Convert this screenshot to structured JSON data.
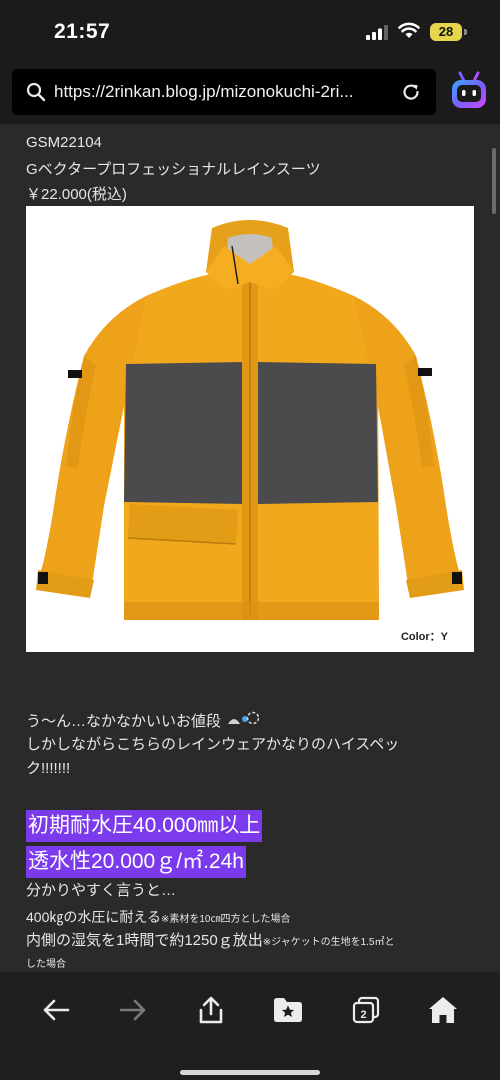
{
  "status_bar": {
    "time": "21:57",
    "battery": "28"
  },
  "browser": {
    "url": "https://2rinkan.blog.jp/mizonokuchi-2ri...",
    "accent": "#7c3aed"
  },
  "product": {
    "code": "GSM22104",
    "name": "Gベクタープロフェッショナルレインスーツ",
    "price": "￥22.000(税込)",
    "color_label": "Color：Y",
    "jacket_colors": {
      "body": "#f2a81c",
      "panel": "#4b4b4d"
    }
  },
  "text": {
    "line1": "う〜ん…なかなかいいお値段",
    "line2": "しかしながらこちらのレインウェアかなりのハイスペッ",
    "line3": "ク!!!!!!!",
    "highlight1": "初期耐水圧40.000㎜以上",
    "highlight2": "透水性20.000ｇ/㎡.24h",
    "line4": "分かりやすく言うと…",
    "line5_main": "400㎏の水圧に耐える",
    "line5_note": "※素材を10㎝四方とした場合",
    "line6_main": "内側の湿気を1時間で約1250ｇ放出",
    "line6_note": "※ジャケットの生地を1.5㎡と",
    "line7_note": "した場合"
  },
  "toolbar": {
    "tabs_count": "2"
  },
  "icons": [
    "search-icon",
    "reload-icon",
    "ai-assistant-icon",
    "back-icon",
    "forward-icon",
    "share-icon",
    "bookmarks-icon",
    "tabs-icon",
    "home-icon"
  ]
}
